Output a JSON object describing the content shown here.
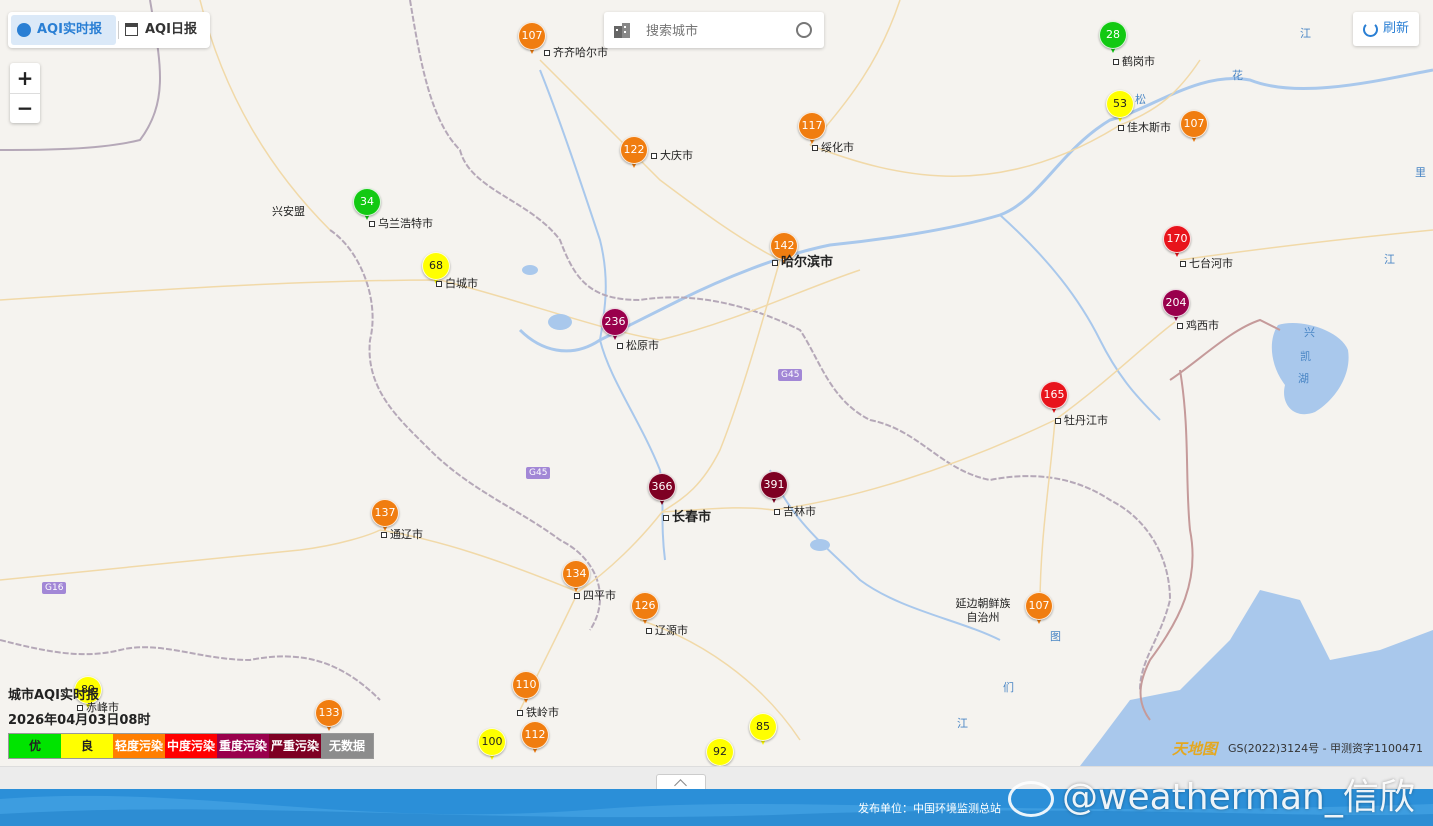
{
  "tabs": {
    "realtime": "AQI实时报",
    "daily": "AQI日报"
  },
  "zoom": {
    "in": "+",
    "out": "−"
  },
  "search": {
    "placeholder": "搜索城市"
  },
  "refresh": {
    "label": "刷新"
  },
  "stations": [
    {
      "id": "qiqihaer",
      "value": "107",
      "label": "齐齐哈尔市",
      "level": "light"
    },
    {
      "id": "daqing",
      "value": "122",
      "label": "大庆市",
      "level": "light"
    },
    {
      "id": "suihua",
      "value": "117",
      "label": "绥化市",
      "level": "light"
    },
    {
      "id": "hegang",
      "value": "28",
      "label": "鹤岗市",
      "level": "excellent"
    },
    {
      "id": "jiamusi",
      "value": "53",
      "label": "佳木斯市",
      "level": "good"
    },
    {
      "id": "jiamusi_e",
      "value": "107",
      "label": "",
      "level": "light"
    },
    {
      "id": "ulanhot",
      "value": "34",
      "label": "乌兰浩特市",
      "level": "excellent"
    },
    {
      "id": "baicheng",
      "value": "68",
      "label": "白城市",
      "level": "good"
    },
    {
      "id": "harbin",
      "value": "142",
      "label": "哈尔滨市",
      "level": "light"
    },
    {
      "id": "qitaihe",
      "value": "170",
      "label": "七台河市",
      "level": "moderate"
    },
    {
      "id": "jixi",
      "value": "204",
      "label": "鸡西市",
      "level": "heavy"
    },
    {
      "id": "songyuan",
      "value": "236",
      "label": "松原市",
      "level": "heavy"
    },
    {
      "id": "mudanjiang",
      "value": "165",
      "label": "牡丹江市",
      "level": "moderate"
    },
    {
      "id": "changchun",
      "value": "366",
      "label": "长春市",
      "level": "severe"
    },
    {
      "id": "jilin",
      "value": "391",
      "label": "吉林市",
      "level": "severe"
    },
    {
      "id": "tongliao",
      "value": "137",
      "label": "通辽市",
      "level": "light"
    },
    {
      "id": "siping",
      "value": "134",
      "label": "四平市",
      "level": "light"
    },
    {
      "id": "liaoyuan",
      "value": "126",
      "label": "辽源市",
      "level": "light"
    },
    {
      "id": "yanbian",
      "value": "107",
      "label": "",
      "level": "light"
    },
    {
      "id": "tieling",
      "value": "110",
      "label": "铁岭市",
      "level": "light"
    },
    {
      "id": "fuxin",
      "value": "133",
      "label": "",
      "level": "light"
    },
    {
      "id": "chifeng",
      "value": "89",
      "label": "赤峰市",
      "level": "good"
    },
    {
      "id": "s100",
      "value": "100",
      "label": "",
      "level": "good"
    },
    {
      "id": "s112",
      "value": "112",
      "label": "",
      "level": "light"
    },
    {
      "id": "s92",
      "value": "92",
      "label": "",
      "level": "good"
    },
    {
      "id": "s85",
      "value": "85",
      "label": "",
      "level": "good"
    }
  ],
  "region_labels": {
    "xinganmeng": "兴安盟",
    "yanbian": "延边朝鲜族\n自治州"
  },
  "water_labels": {
    "song": "松",
    "hua": "花",
    "jiang1": "江",
    "li": "里",
    "jiang2": "江",
    "xing": "兴",
    "kai": "凯",
    "hu": "湖",
    "tu": "图",
    "men": "们",
    "jiang3": "江"
  },
  "highways": {
    "g45a": "G45",
    "g45b": "G45",
    "g16": "G16"
  },
  "legend": {
    "title": "城市AQI实时报",
    "time": "2026年04月03日08时",
    "items": [
      {
        "label": "优",
        "color": "#00e400",
        "text": "#222"
      },
      {
        "label": "良",
        "color": "#ffff00",
        "text": "#222"
      },
      {
        "label": "轻度污染",
        "color": "#ff7e00",
        "text": "#fff"
      },
      {
        "label": "中度污染",
        "color": "#ff0000",
        "text": "#fff"
      },
      {
        "label": "重度污染",
        "color": "#99004c",
        "text": "#fff"
      },
      {
        "label": "严重污染",
        "color": "#7e0023",
        "text": "#fff"
      },
      {
        "label": "无数据",
        "color": "#8c8c8c",
        "text": "#fff"
      }
    ]
  },
  "level_colors": {
    "excellent": "#12c912",
    "good": "#ffff00",
    "light": "#f07d10",
    "moderate": "#e8141c",
    "heavy": "#99004c",
    "severe": "#7e0023"
  },
  "copyright": "GS(2022)3124号 - 甲测资字1100471",
  "tdt_logo": "天地图",
  "publisher": "发布单位：中国环境监测总站",
  "watermark": "@weatherman_信欣"
}
